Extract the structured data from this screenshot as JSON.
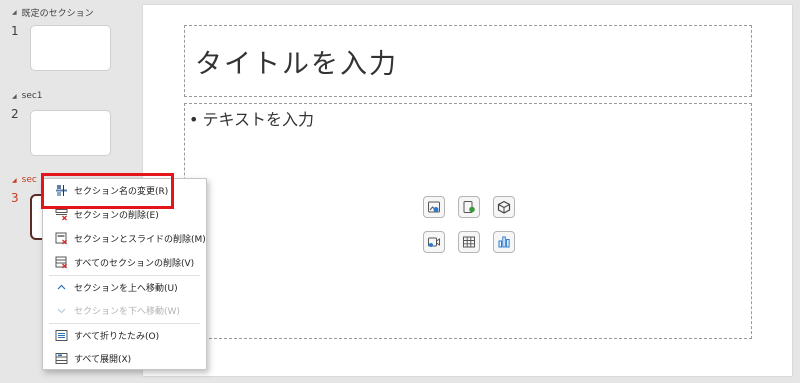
{
  "slide_panel": {
    "sections": [
      {
        "label": "既定のセクション",
        "slide_number": "1"
      },
      {
        "label": "sec1",
        "slide_number": "2"
      },
      {
        "label": "sec",
        "slide_number": "3"
      }
    ]
  },
  "slide": {
    "title_placeholder": "タイトルを入力",
    "body_placeholder": "テキストを入力",
    "bullet": "•"
  },
  "context_menu": {
    "items": [
      {
        "label": "セクション名の変更(R)",
        "icon": "rename-section-icon"
      },
      {
        "label": "セクションの削除(E)",
        "icon": "delete-section-icon"
      },
      {
        "label": "セクションとスライドの削除(M)",
        "icon": "delete-section-slides-icon"
      },
      {
        "label": "すべてのセクションの削除(V)",
        "icon": "delete-all-sections-icon"
      },
      {
        "label": "セクションを上へ移動(U)",
        "icon": "chevron-up-icon"
      },
      {
        "label": "セクションを下へ移動(W)",
        "icon": "chevron-down-icon",
        "disabled": true
      },
      {
        "label": "すべて折りたたみ(O)",
        "icon": "collapse-all-icon"
      },
      {
        "label": "すべて展開(X)",
        "icon": "expand-all-icon"
      }
    ]
  },
  "colors": {
    "accent": "#c43e1c",
    "highlight": "#e3151a",
    "selected_thumb_border": "#5a2a27"
  }
}
